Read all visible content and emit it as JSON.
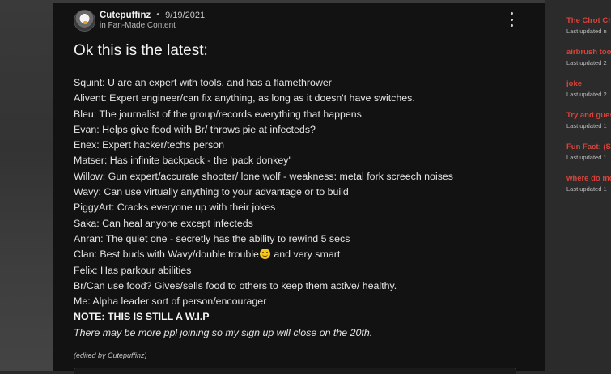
{
  "post": {
    "author": "Cutepuffinz",
    "separator": "•",
    "date": "9/19/2021",
    "category": "in Fan-Made Content",
    "title": "Ok this is the latest:",
    "lines": [
      "Squint: U are an expert with tools, and has a flamethrower",
      "Alivent: Expert engineer/can fix anything, as long as it doesn't have switches.",
      "Bleu: The journalist of the group/records everything that happens",
      "Evan: Helps give food with Br/ throws pie at infecteds?",
      "Enex: Expert hacker/techs person",
      "Matser: Has infinite backpack - the 'pack donkey'",
      "Willow: Gun expert/accurate shooter/ lone wolf - weakness: metal fork screech noises",
      "Wavy: Can use virtually anything to your advantage or to build",
      "PiggyArt: Cracks everyone up with their jokes",
      "Saka: Can heal anyone except infecteds",
      "Anran: The quiet one - secretly has the ability to rewind 5 secs"
    ],
    "clan_line_before": "Clan: Best buds with Wavy/double trouble",
    "clan_line_after": " and very smart",
    "clan_emoji": "winking-face-emoji",
    "lines_after": [
      "Felix: Has parkour abilities",
      "Br/Can use food? Gives/sells food to others to keep them active/ healthy.",
      "Me: Alpha leader sort of person/encourager"
    ],
    "note": "NOTE: THIS IS STILL A W.I.P",
    "italic_note": "There may be more ppl joining so my sign up will close on the 20th.",
    "edited": "(edited by Cutepuffinz)"
  },
  "sidebar": {
    "items": [
      {
        "title": "The Clrot Ch",
        "updated": "Last updated n"
      },
      {
        "title": "airbrush too",
        "updated": "Last updated 2"
      },
      {
        "title": "joke",
        "updated": "Last updated 2"
      },
      {
        "title": "Try and gues",
        "updated": "Last updated 1"
      },
      {
        "title": "Fun Fact: (S",
        "updated": "Last updated 1"
      },
      {
        "title": "where do mo",
        "updated": "Last updated 1"
      }
    ]
  },
  "colors": {
    "accent": "#d9433a",
    "card_bg": "#121212",
    "page_bg": "#2a2a2a"
  }
}
